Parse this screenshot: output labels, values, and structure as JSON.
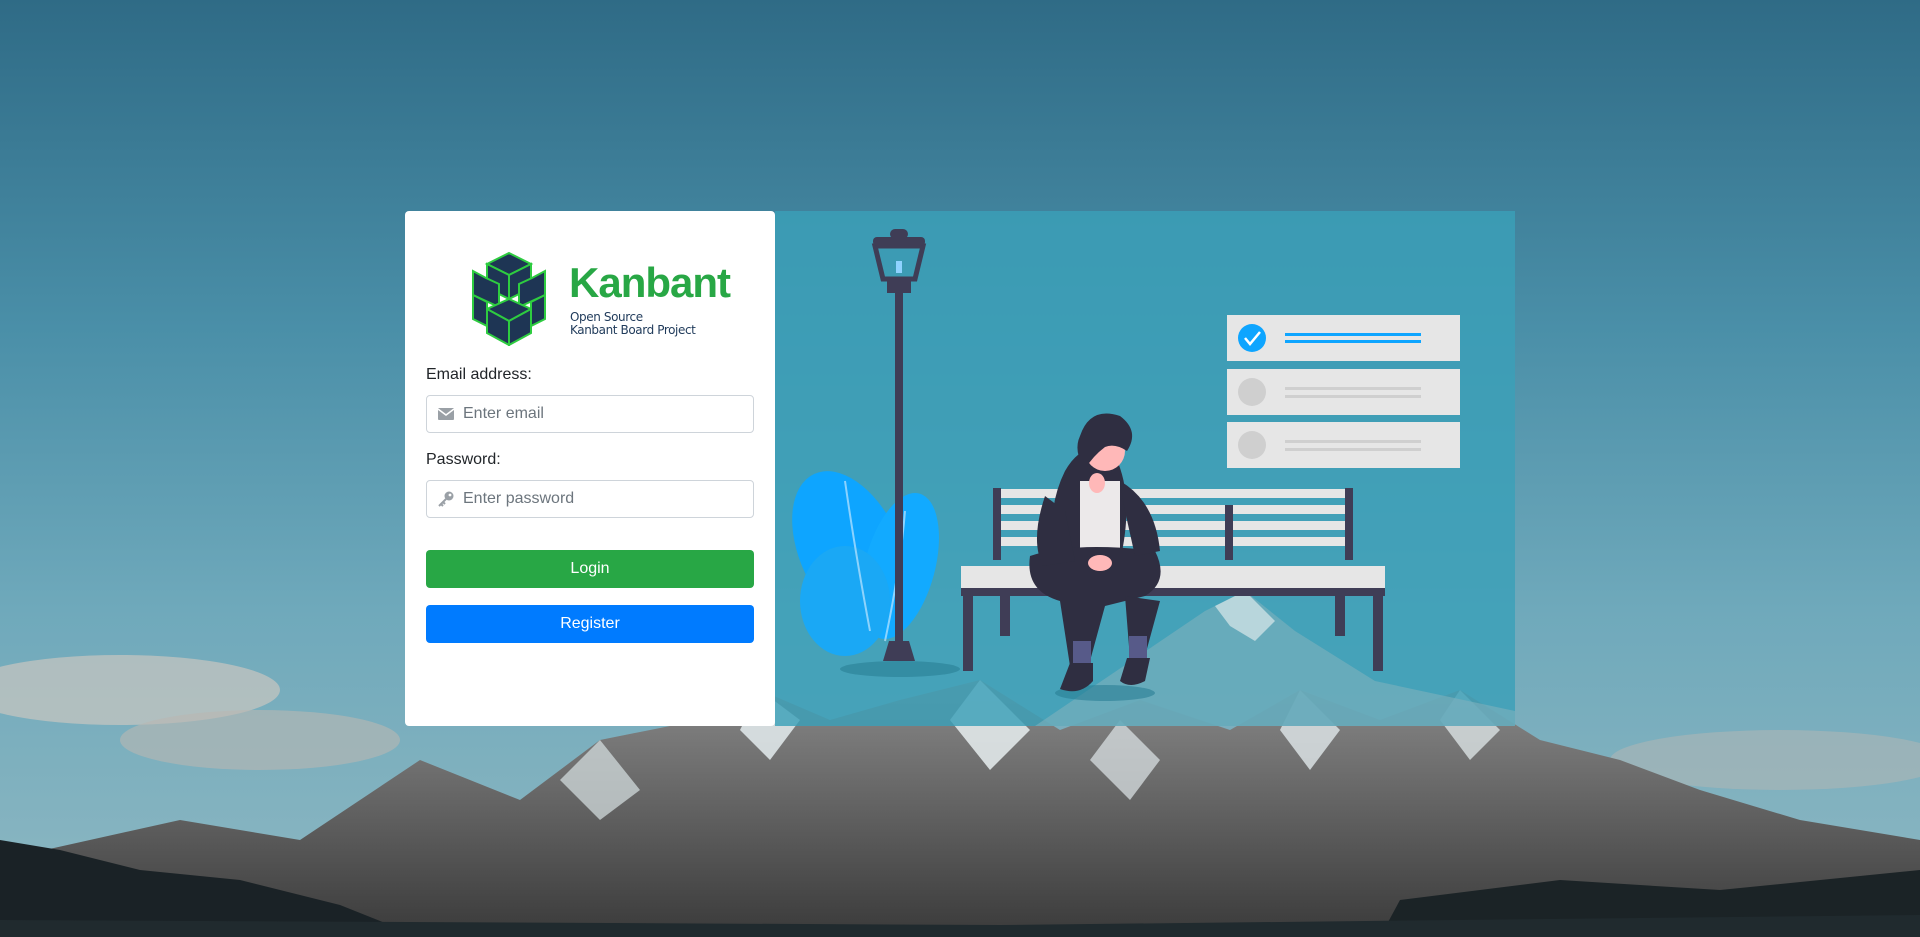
{
  "brand": {
    "name": "Kanbant",
    "tagline_line1": "Open Source",
    "tagline_line2": "Kanbant Board Project"
  },
  "login_form": {
    "email_label": "Email address:",
    "email_placeholder": "Enter email",
    "email_value": "",
    "password_label": "Password:",
    "password_placeholder": "Enter password",
    "password_value": "",
    "login_button": "Login",
    "register_button": "Register"
  },
  "icons": {
    "email": "envelope-icon",
    "password": "key-icon"
  },
  "colors": {
    "login": "#28a745",
    "register": "#007bff",
    "brand": "#28a745",
    "panel": "#3aa0b8"
  }
}
